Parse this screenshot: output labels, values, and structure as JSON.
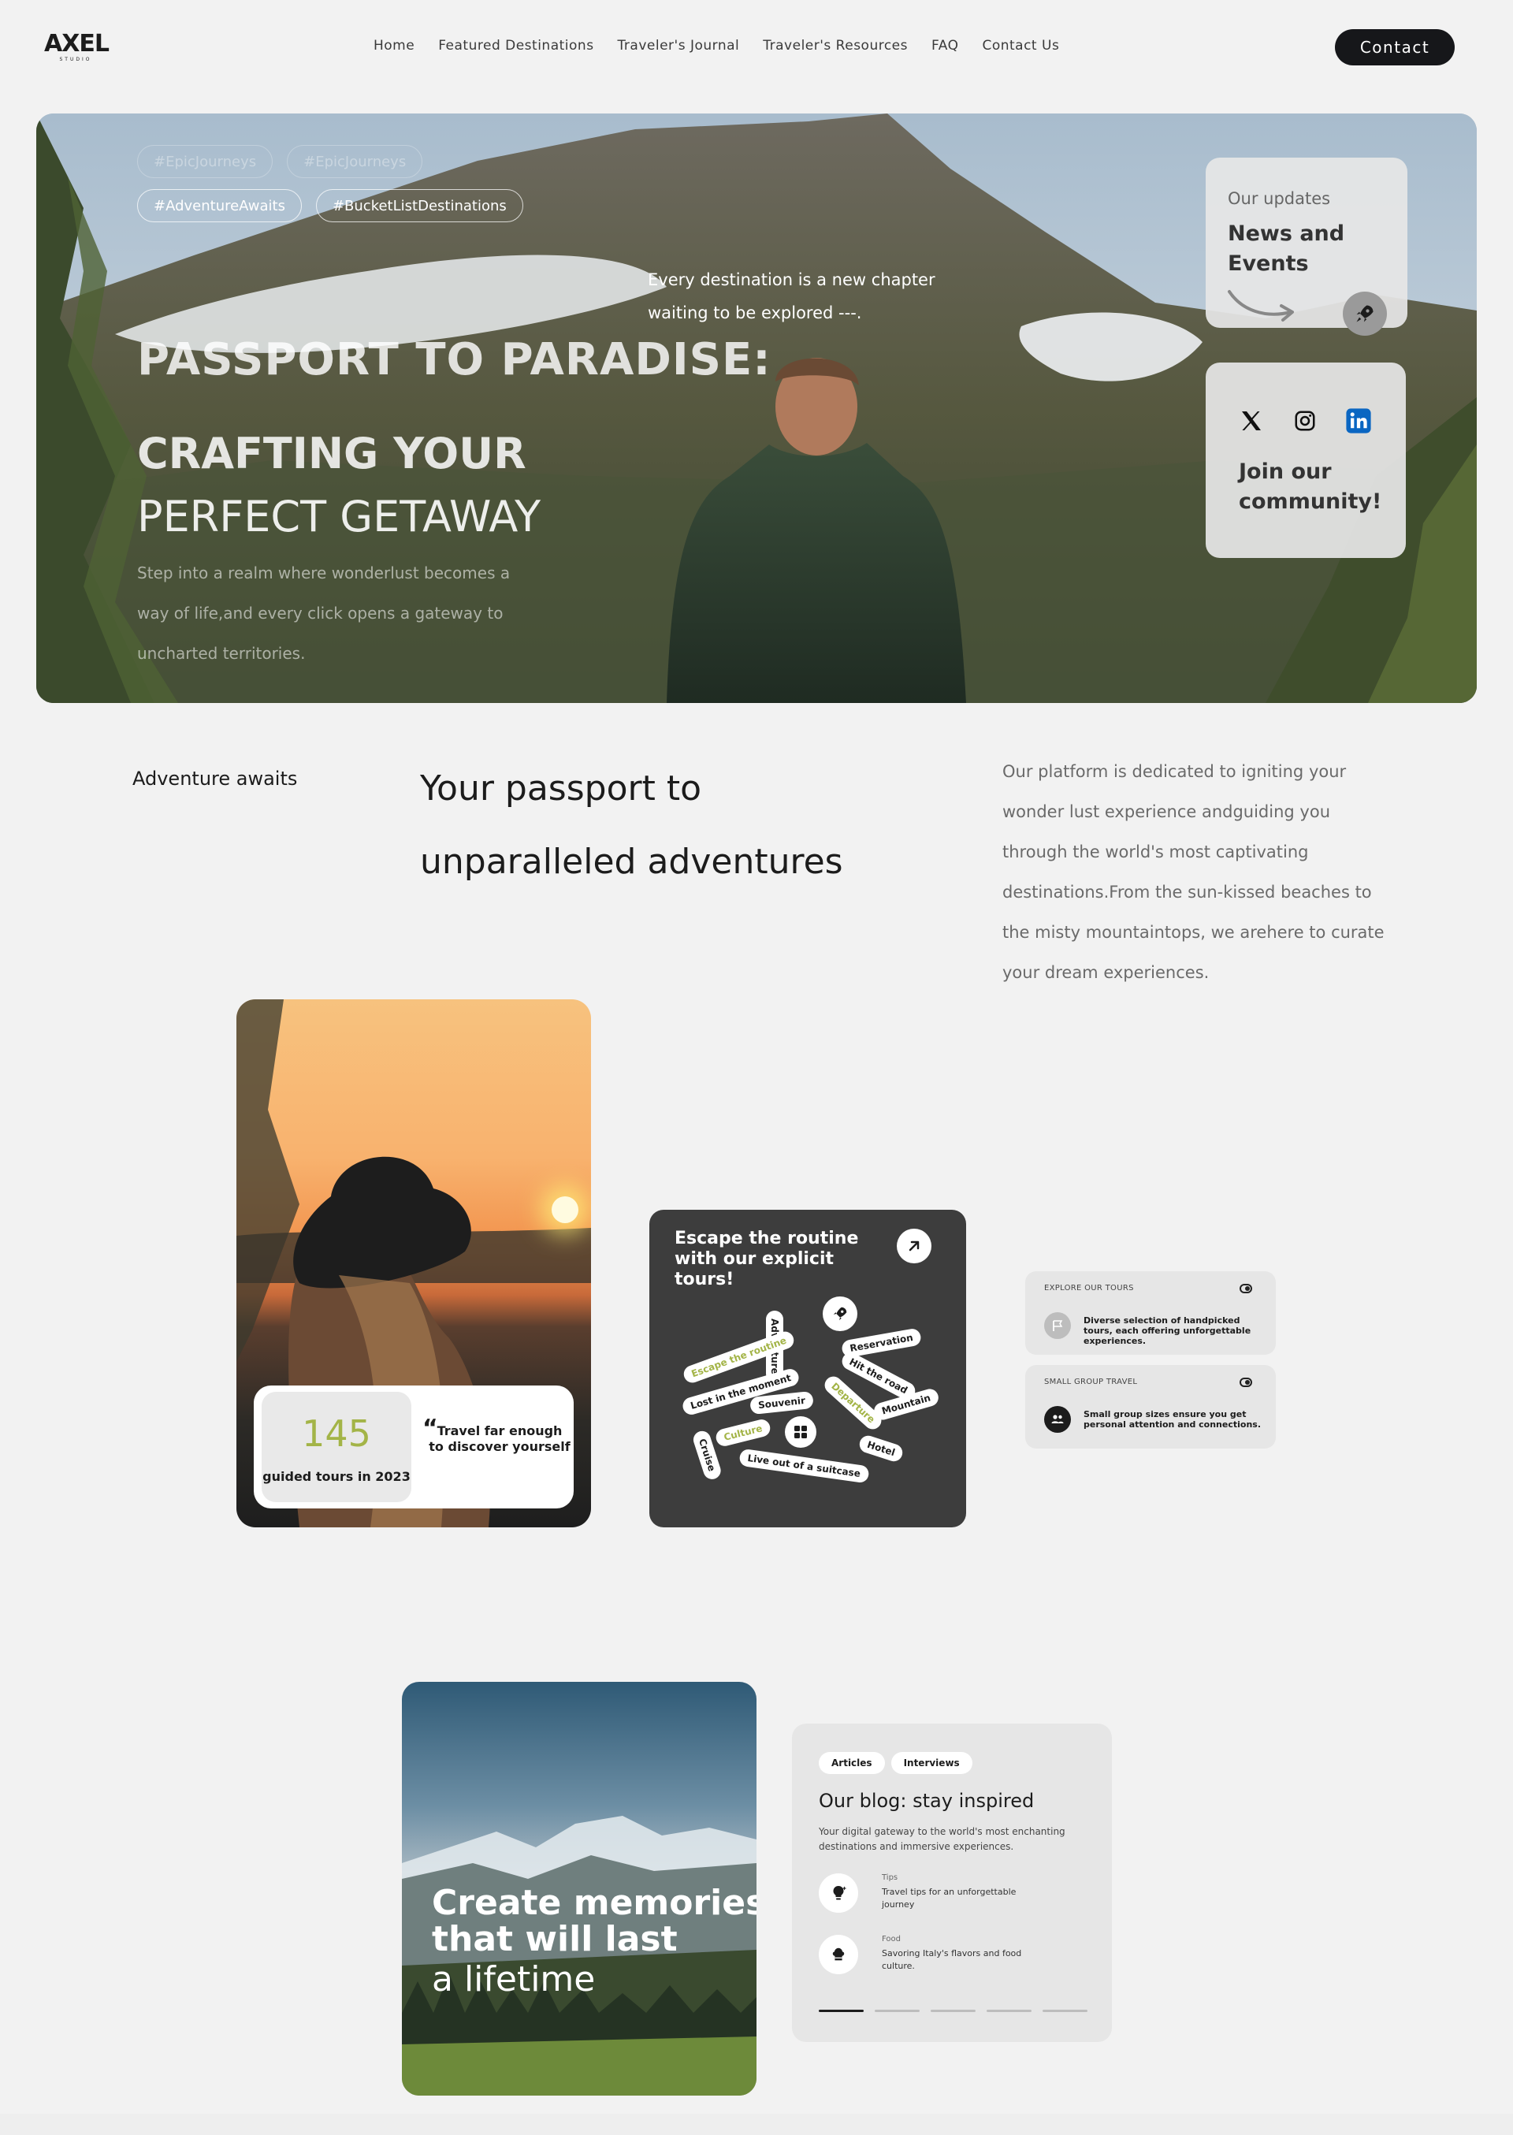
{
  "nav": {
    "logo_text": "AXEL",
    "logo_sub": "STUDIO",
    "links": [
      "Home",
      "Featured Destinations",
      "Traveler's Journal",
      "Traveler's Resources",
      "FAQ",
      "Contact Us"
    ],
    "contact_label": "Contact"
  },
  "hero": {
    "tags_row1": [
      "#EpicJourneys",
      "#EpicJourneys"
    ],
    "tags_row2": [
      "#AdventureAwaits",
      "#BucketListDestinations"
    ],
    "quote": "Every destination is a new chapter waiting to be explored ---.",
    "title1": "PASSPORT TO PARADISE:",
    "title2": "CRAFTING YOUR",
    "title3": "PERFECT GETAWAY",
    "description": "Step into a realm where wonderlust becomes a way of life,and every click opens a gateway to uncharted territories."
  },
  "updates": {
    "label": "Our updates",
    "title": "News and Events"
  },
  "community": {
    "text": "Join our community!",
    "social_icons": [
      "x-icon",
      "instagram-icon",
      "linkedin-icon"
    ],
    "linkedin_color": "#0a66c2"
  },
  "intro": {
    "eyebrow": "Adventure awaits",
    "title": "Your passport to unparalleled adventures",
    "body": "Our platform is dedicated to igniting your wonder lust experience andguiding you through the world's most captivating destinations.From the sun-kissed beaches to the misty mountaintops, we arehere to curate your dream experiences."
  },
  "stat": {
    "number": "145",
    "label": "guided tours in 2023",
    "quote_mark": "“",
    "quote": "Travel far enough to discover yourself",
    "accent": "#a3b447"
  },
  "tours": {
    "title": "Escape the routine with our explicit tours!",
    "pills": [
      "Adventure",
      "Reservation",
      "Escape the routine",
      "Hit the road",
      "Lost in the moment",
      "Souvenir",
      "Departure",
      "Mountain",
      "Culture",
      "Hotel",
      "Cruise",
      "Live out of a suitcase"
    ]
  },
  "mini_cards": [
    {
      "header": "EXPLORE OUR TOURS",
      "text": "Diverse selection of handpicked tours, each offering unforgettable experiences."
    },
    {
      "header": "SMALL GROUP TRAVEL",
      "text": "Small group sizes ensure you get personal attention and connections."
    }
  ],
  "memories": {
    "line1": "Create memories",
    "line2": "that will last",
    "line3": "a lifetime"
  },
  "blog": {
    "tabs": [
      "Articles",
      "Interviews"
    ],
    "title": "Our blog: stay inspired",
    "description": "Your digital gateway to the world's most enchanting destinations and immersive experiences.",
    "items": [
      {
        "category": "Tips",
        "text": "Travel tips for an unforgettable journey"
      },
      {
        "category": "Food",
        "text": "Savoring Italy's flavors and food culture."
      }
    ],
    "progress_active": 1,
    "progress_total": 5
  }
}
